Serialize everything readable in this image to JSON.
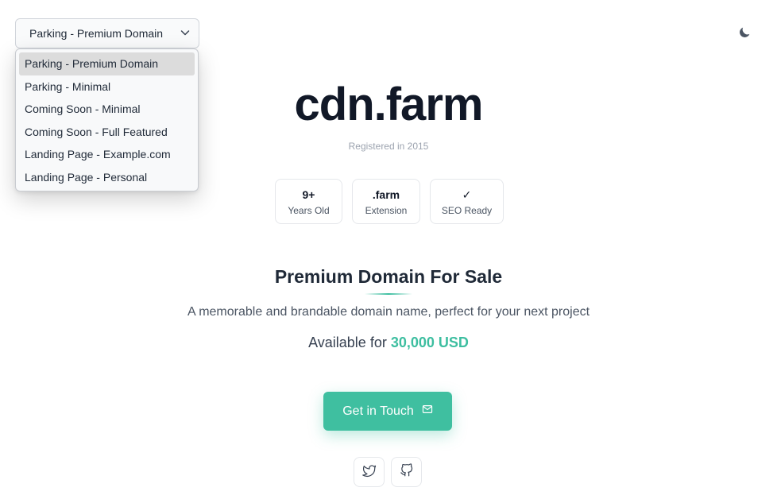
{
  "template_select": {
    "selected": "Parking - Premium Domain",
    "options": [
      "Parking - Premium Domain",
      "Parking - Minimal",
      "Coming Soon - Minimal",
      "Coming Soon - Full Featured",
      "Landing Page - Example.com",
      "Landing Page - Personal"
    ]
  },
  "hero": {
    "domain": "cdn.farm",
    "registered": "Registered in 2015"
  },
  "stats": [
    {
      "value": "9+",
      "label": "Years Old"
    },
    {
      "value": ".farm",
      "label": "Extension"
    },
    {
      "value": "✓",
      "label": "SEO Ready"
    }
  ],
  "sale": {
    "title": "Premium Domain For Sale",
    "tagline": "A memorable and brandable domain name, perfect for your next project",
    "price_prefix": "Available for",
    "price_amount": "30,000 USD"
  },
  "cta": {
    "label": "Get in Touch",
    "icon": "mail-icon"
  },
  "socials": [
    {
      "icon": "twitter-icon"
    },
    {
      "icon": "github-icon"
    }
  ],
  "theme_toggle": {
    "icon": "moon-icon"
  },
  "colors": {
    "accent": "#3fbfa0",
    "text": "#111827",
    "muted": "#9ca3af"
  }
}
